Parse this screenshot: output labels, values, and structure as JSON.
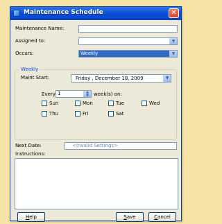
{
  "window": {
    "title": "Maintenance Schedule",
    "close_glyph": "✕"
  },
  "form": {
    "maintenance_name_label": "Maintenance Name:",
    "maintenance_name_value": "",
    "assigned_to_label": "Assigned to:",
    "assigned_to_value": "",
    "occurs_label": "Occurs:",
    "occurs_value": "Weekly"
  },
  "weekly": {
    "group_title": "Weekly",
    "maint_start_label": "Maint Start:",
    "maint_start_value": "Friday , December 18, 2009",
    "every_label": "Every",
    "every_value": "1",
    "weeks_on_label": "week(s) on:",
    "days": [
      "Sun",
      "Mon",
      "Tue",
      "Wed",
      "Thu",
      "Fri",
      "Sat"
    ]
  },
  "next_date": {
    "label": "Next Date:",
    "value": "<Invalid Settings>"
  },
  "instructions": {
    "label": "Instructions:",
    "value": ""
  },
  "buttons": {
    "help": "Help",
    "save": "Save",
    "cancel": "Cancel"
  },
  "colors": {
    "title_bar": "#0b4fd7",
    "selection": "#316ac5",
    "group_title": "#0046d5",
    "background": "#f6e3a6"
  },
  "icons": {
    "app": "app-icon",
    "close": "close-icon",
    "dropdown": "chevron-down-icon",
    "spinner": "spinner-icon"
  }
}
